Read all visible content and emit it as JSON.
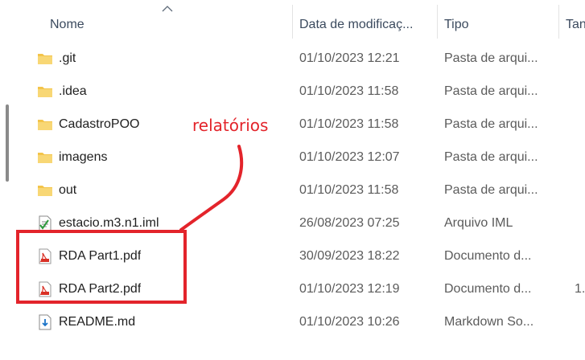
{
  "header": {
    "columns": [
      {
        "label": "Nome"
      },
      {
        "label": "Data de modificaç..."
      },
      {
        "label": "Tipo"
      },
      {
        "label": "Tan"
      }
    ]
  },
  "rows": [
    {
      "name": ".git",
      "date": "01/10/2023 12:21",
      "type": "Pasta de arqui...",
      "size": "",
      "icon": "folder-icon"
    },
    {
      "name": ".idea",
      "date": "01/10/2023 11:58",
      "type": "Pasta de arqui...",
      "size": "",
      "icon": "folder-icon"
    },
    {
      "name": "CadastroPOO",
      "date": "01/10/2023 11:58",
      "type": "Pasta de arqui...",
      "size": "",
      "icon": "folder-icon"
    },
    {
      "name": "imagens",
      "date": "01/10/2023 12:07",
      "type": "Pasta de arqui...",
      "size": "",
      "icon": "folder-icon"
    },
    {
      "name": "out",
      "date": "01/10/2023 11:58",
      "type": "Pasta de arqui...",
      "size": "",
      "icon": "folder-icon"
    },
    {
      "name": "estacio.m3.n1.iml",
      "date": "26/08/2023 07:25",
      "type": "Arquivo IML",
      "size": "",
      "icon": "iml-file-icon"
    },
    {
      "name": "RDA Part1.pdf",
      "date": "30/09/2023 18:22",
      "type": "Documento d...",
      "size": "",
      "icon": "pdf-file-icon"
    },
    {
      "name": "RDA Part2.pdf",
      "date": "01/10/2023 12:19",
      "type": "Documento d...",
      "size": "1.",
      "icon": "pdf-file-icon"
    },
    {
      "name": "README.md",
      "date": "01/10/2023 10:26",
      "type": "Markdown So...",
      "size": "",
      "icon": "markdown-file-icon"
    }
  ],
  "annotation": {
    "label": "relatórios",
    "color": "#e3242b"
  },
  "colors": {
    "folder": "#f3c44a",
    "pdf": "#d93025",
    "annotation": "#e3242b"
  }
}
